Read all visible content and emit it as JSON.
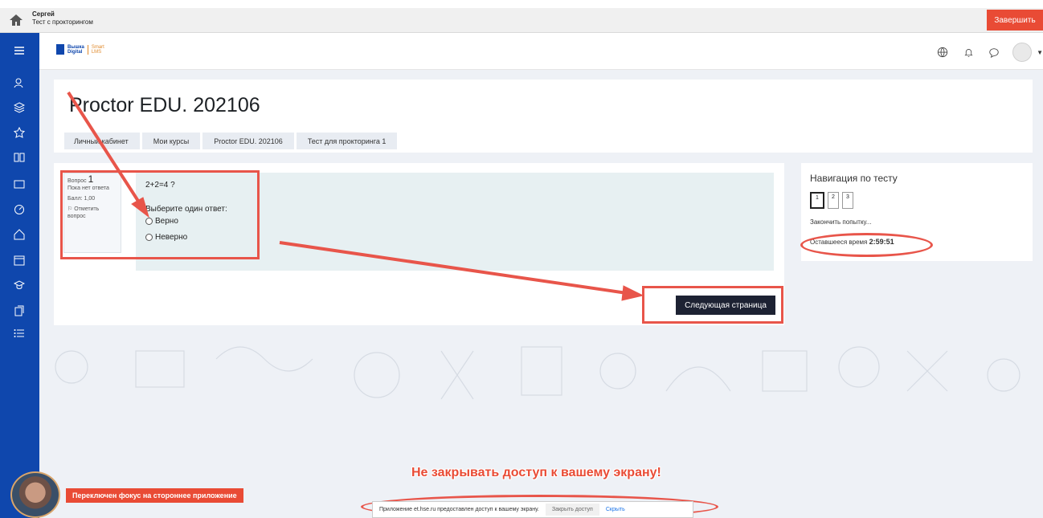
{
  "proctor": {
    "user_name": "Сергей",
    "test_name": "Тест с прокторингом",
    "finish_label": "Завершить"
  },
  "logo": {
    "main": "Вышка\nDigital",
    "sub": "Smart\nLMS"
  },
  "page": {
    "title": "Proctor EDU. 202106",
    "breadcrumb": [
      "Личный кабинет",
      "Мои курсы",
      "Proctor EDU. 202106",
      "Тест для прокторинга 1"
    ]
  },
  "question": {
    "label": "Вопрос",
    "number": "1",
    "status": "Пока нет ответа",
    "score": "Балл: 1,00",
    "flag_label": "Отметить вопрос",
    "text": "2+2=4 ?",
    "prompt": "Выберите один ответ:",
    "options": [
      "Верно",
      "Неверно"
    ],
    "next_label": "Следующая страница"
  },
  "quiz_nav": {
    "title": "Навигация по тесту",
    "pages": [
      "1",
      "2",
      "3"
    ],
    "finish_link": "Закончить попытку...",
    "time_label": "Оставшееся время",
    "time_value": "2:59:51"
  },
  "warnings": {
    "focus": "Переключен фокус на стороннее приложение",
    "screen": "Не закрывать доступ к вашему экрану!",
    "share_text": "Приложение et.hse.ru предоставлен доступ к вашему экрану.",
    "share_stop": "Закрыть доступ",
    "share_hide": "Скрыть"
  },
  "colors": {
    "sidebar": "#0f47ad",
    "accent_red": "#e94b35",
    "annotation": "#e8554a",
    "next_button": "#1d2233"
  }
}
